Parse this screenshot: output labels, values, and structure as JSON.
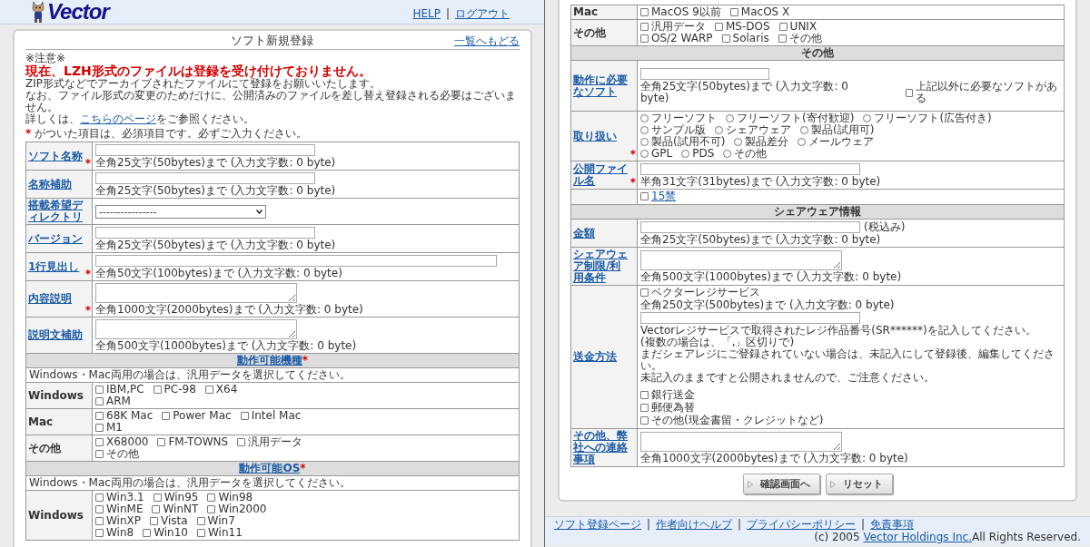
{
  "left_view": {
    "header": {
      "logo": "Vector",
      "links": [
        "HELP",
        "ログアウト"
      ],
      "separator": "|"
    },
    "card": {
      "title": "ソフト新規登録",
      "back_link": "一覧へもどる",
      "notice": {
        "mark": "※注意※",
        "headline": "現在、LZH形式のファイルは登録を受け付けておりません。",
        "lines": [
          "ZIP形式などでアーカイブされたファイルにて登録をお願いいたします。",
          "なお、ファイル形式の変更のためだけに、公開済みのファイルを差し替え登録される必要はございません。"
        ],
        "detail": {
          "before": "詳しくは、",
          "link": "こちらのページ",
          "after": "をご参照ください。"
        }
      },
      "required_mark": "*",
      "required_note": "がついた項目は、必須項目です。必ずご入力ください。",
      "rows": [
        {
          "kind": "input",
          "label": "ソフト名称",
          "mark": "*",
          "hint": "全角25文字(50bytes)まで (入力文字数: 0 byte)"
        },
        {
          "kind": "input",
          "label": "名称補助",
          "hint": "全角25文字(50bytes)まで (入力文字数: 0 byte)"
        },
        {
          "kind": "select",
          "label": "搭載希望ディレクトリ",
          "value": "----------------"
        },
        {
          "kind": "input",
          "label": "バージョン",
          "hint": "全角25文字(50bytes)まで (入力文字数: 0 byte)"
        },
        {
          "kind": "input",
          "label": "1行見出し",
          "mark": "*",
          "wide": true,
          "hint": "全角50文字(100bytes)まで (入力文字数: 0 byte)"
        },
        {
          "kind": "textarea",
          "label": "内容説明",
          "mark": "*",
          "hint": "全角1000文字(2000bytes)まで (入力文字数: 0 byte)"
        },
        {
          "kind": "textarea",
          "label": "説明文補助",
          "hint": "全角500文字(1000bytes)まで (入力文字数: 0 byte)"
        },
        {
          "kind": "section",
          "title": "動作可能機種",
          "mark": "*",
          "linked": true
        },
        {
          "kind": "note",
          "text": "Windows・Mac両用の場合は、汎用データを選択してください。"
        },
        {
          "kind": "checkgroup",
          "label": "Windows",
          "lines": [
            [
              {
                "label": "IBM,PC",
                "checked": false
              },
              {
                "label": "PC-98",
                "checked": false
              },
              {
                "label": "X64",
                "checked": false
              }
            ],
            [
              {
                "label": "ARM",
                "checked": false
              }
            ]
          ]
        },
        {
          "kind": "checkgroup",
          "label": "Mac",
          "lines": [
            [
              {
                "label": "68K Mac",
                "checked": false
              },
              {
                "label": "Power Mac",
                "checked": false
              },
              {
                "label": "Intel Mac",
                "checked": false
              }
            ],
            [
              {
                "label": "M1",
                "checked": false
              }
            ]
          ]
        },
        {
          "kind": "checkgroup",
          "label": "その他",
          "lines": [
            [
              {
                "label": "X68000",
                "checked": false
              },
              {
                "label": "FM-TOWNS",
                "checked": false
              },
              {
                "label": "汎用データ",
                "checked": false
              }
            ],
            [
              {
                "label": "その他",
                "checked": false
              }
            ]
          ]
        },
        {
          "kind": "section",
          "title": "動作可能OS",
          "mark": "*",
          "linked": true
        },
        {
          "kind": "note",
          "text": "Windows・Mac両用の場合は、汎用データを選択してください。"
        },
        {
          "kind": "checkgroup",
          "label": "Windows",
          "lines": [
            [
              {
                "label": "Win3.1",
                "checked": false
              },
              {
                "label": "Win95",
                "checked": false
              },
              {
                "label": "Win98",
                "checked": false
              }
            ],
            [
              {
                "label": "WinME",
                "checked": false
              },
              {
                "label": "WinNT",
                "checked": false
              },
              {
                "label": "Win2000",
                "checked": false
              }
            ],
            [
              {
                "label": "WinXP",
                "checked": false
              },
              {
                "label": "Vista",
                "checked": false
              },
              {
                "label": "Win7",
                "checked": false
              }
            ],
            [
              {
                "label": "Win8",
                "checked": false
              },
              {
                "label": "Win10",
                "checked": false
              },
              {
                "label": "Win11",
                "checked": false
              }
            ]
          ]
        }
      ]
    }
  },
  "right_view": {
    "rows": [
      {
        "kind": "checkgroup",
        "label": "Mac",
        "lines": [
          [
            {
              "label": "MacOS 9以前",
              "checked": false
            },
            {
              "label": "MacOS X",
              "checked": false
            }
          ]
        ]
      },
      {
        "kind": "checkgroup",
        "label": "その他",
        "lines": [
          [
            {
              "label": "汎用データ",
              "checked": false
            },
            {
              "label": "MS-DOS",
              "checked": false
            },
            {
              "label": "UNIX",
              "checked": false
            }
          ],
          [
            {
              "label": "OS/2 WARP",
              "checked": false
            },
            {
              "label": "Solaris",
              "checked": false
            },
            {
              "label": "その他",
              "checked": false
            }
          ]
        ]
      },
      {
        "kind": "section",
        "title": "その他",
        "linked": false
      },
      {
        "kind": "input",
        "label": "動作に必要なソフト",
        "hint": "全角25文字(50bytes)まで (入力文字数: 0 byte)",
        "extra_check": {
          "label": "上記以外に必要なソフトがある",
          "checked": false
        }
      },
      {
        "kind": "radiogroup",
        "label": "取り扱い",
        "mark": "*",
        "lines": [
          [
            {
              "label": "フリーソフト",
              "selected": false
            },
            {
              "label": "フリーソフト(寄付歓迎)",
              "selected": false
            },
            {
              "label": "フリーソフト(広告付き)",
              "selected": false
            }
          ],
          [
            {
              "label": "サンプル版",
              "selected": false
            },
            {
              "label": "シェアウェア",
              "selected": false
            },
            {
              "label": "製品(試用可)",
              "selected": false
            }
          ],
          [
            {
              "label": "製品(試用不可)",
              "selected": false
            },
            {
              "label": "製品差分",
              "selected": false
            },
            {
              "label": "メールウェア",
              "selected": false
            }
          ],
          [
            {
              "label": "GPL",
              "selected": false
            },
            {
              "label": "PDS",
              "selected": false
            },
            {
              "label": "その他",
              "selected": false
            }
          ]
        ]
      },
      {
        "kind": "input",
        "label": "公開ファイル名",
        "mark": "*",
        "hint": "半角31文字(31bytes)まで (入力文字数: 0 byte)"
      },
      {
        "kind": "check_link",
        "check": {
          "label": "15禁",
          "checked": false
        }
      },
      {
        "kind": "section",
        "title": "シェアウェア情報",
        "linked": false
      },
      {
        "kind": "input",
        "label": "金額",
        "suffix": "(税込み)",
        "hint": "全角25文字(50bytes)まで (入力文字数: 0 byte)"
      },
      {
        "kind": "textarea",
        "label": "シェアウェア制限/利用条件",
        "hint": "全角500文字(1000bytes)まで (入力文字数: 0 byte)"
      },
      {
        "kind": "payment",
        "label": "送金方法",
        "service": {
          "label": "ベクターレジサービス",
          "checked": false
        },
        "hint": "全角250文字(500bytes)まで (入力文字数: 0 byte)",
        "lines": [
          "Vectorレジサービスで取得されたレジ作品番号(SR******)を記入してください。",
          "(複数の場合は、「,」区切りで)",
          "まだシェアレジにご登録されていない場合は、未記入にして登録後、編集してください。",
          "未記入のままですと公開されませんので、ご注意ください。"
        ],
        "methods": [
          {
            "label": "銀行送金",
            "checked": false
          },
          {
            "label": "郵便為替",
            "checked": false
          },
          {
            "label": "その他(現金書留・クレジットなど)",
            "checked": false
          }
        ]
      },
      {
        "kind": "textarea",
        "label": "その他、弊社への連絡事項",
        "hint": "全角1000文字(2000bytes)まで (入力文字数: 0 byte)"
      }
    ],
    "buttons": [
      "確認画面へ",
      "リセット"
    ],
    "footer": {
      "links": [
        "ソフト登録ページ",
        "作者向けヘルプ",
        "プライバシーポリシー",
        "免責事項"
      ],
      "separator": "|",
      "copyright": {
        "before": "(c) 2005 ",
        "link": "Vector Holdings Inc.",
        "after": "All Rights Reserved."
      }
    }
  }
}
